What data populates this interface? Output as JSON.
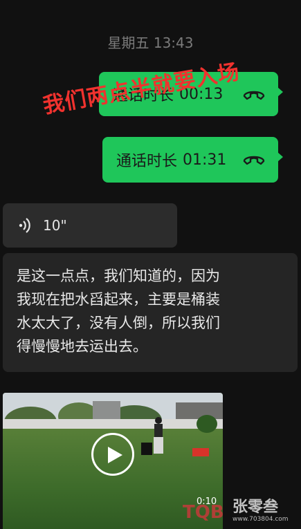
{
  "timestamp": "星期五 13:43",
  "calls": [
    {
      "label": "通话时长",
      "duration": "00:13"
    },
    {
      "label": "通话时长",
      "duration": "01:31"
    }
  ],
  "overlay_note": "我们两点半就要入场",
  "voice_message": {
    "duration": "10\""
  },
  "transcript_lines": [
    "是这一点点，我们知道的，因为",
    "我现在把水舀起来，主要是桶装",
    "水太大了，没有人倒，所以我们",
    "得慢慢地去运出去。"
  ],
  "video": {
    "time": "0:10"
  },
  "watermark": {
    "logo": "TQB",
    "name": "张零叁",
    "url": "www.703804.com"
  },
  "colors": {
    "bubble_green": "#1fc65a",
    "overlay_red": "#f0322e",
    "background": "#111111"
  }
}
